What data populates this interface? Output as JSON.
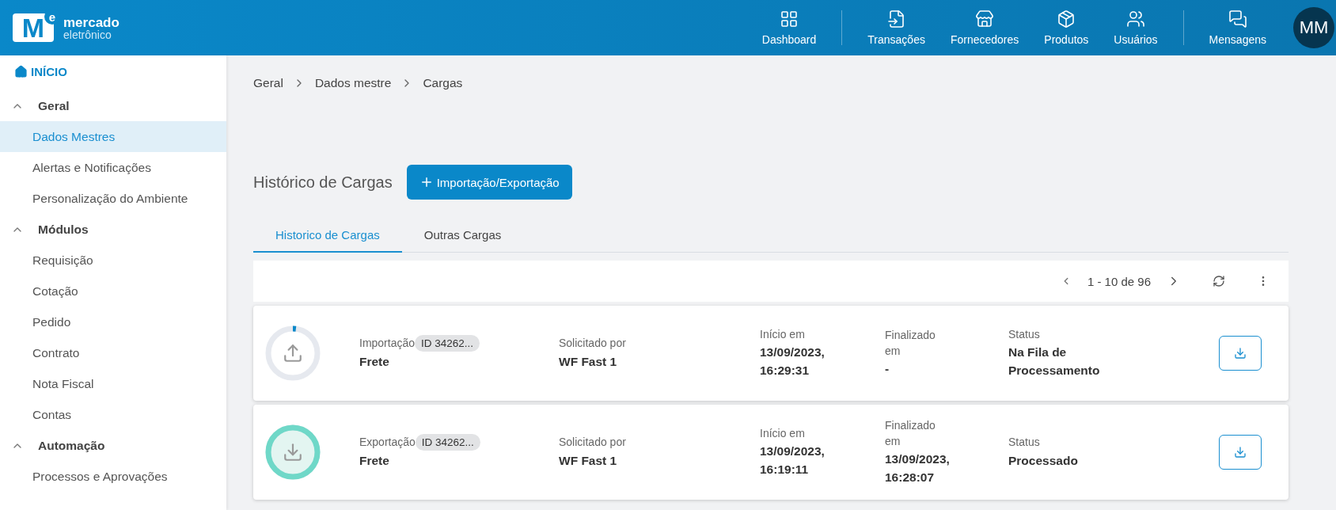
{
  "header": {
    "logo": {
      "letter": "M",
      "mark": "e",
      "name": "mercado",
      "subname": "eletrônico"
    },
    "nav": [
      {
        "label": "Dashboard"
      },
      {
        "label": "Transações"
      },
      {
        "label": "Fornecedores"
      },
      {
        "label": "Produtos"
      },
      {
        "label": "Usuários"
      },
      {
        "label": "Mensagens"
      }
    ],
    "avatar": "MM"
  },
  "sidebar": {
    "home": "INÍCIO",
    "groups": [
      {
        "label": "Geral",
        "expanded": true,
        "items": [
          {
            "label": "Dados Mestres",
            "selected": true
          },
          {
            "label": "Alertas e Notificações",
            "selected": false
          },
          {
            "label": "Personalização do Ambiente",
            "selected": false
          }
        ]
      },
      {
        "label": "Módulos",
        "expanded": true,
        "items": [
          {
            "label": "Requisição",
            "selected": false
          },
          {
            "label": "Cotação",
            "selected": false
          },
          {
            "label": "Pedido",
            "selected": false
          },
          {
            "label": "Contrato",
            "selected": false
          },
          {
            "label": "Nota Fiscal",
            "selected": false
          },
          {
            "label": "Contas",
            "selected": false
          }
        ]
      },
      {
        "label": "Automação",
        "expanded": true,
        "items": [
          {
            "label": "Processos e Aprovações",
            "selected": false
          }
        ]
      }
    ]
  },
  "breadcrumb": [
    "Geral",
    "Dados mestre",
    "Cargas"
  ],
  "title": "Histórico de Cargas",
  "action_button": "Importação/Exportação",
  "tabs": [
    {
      "label": "Historico de Cargas",
      "selected": true
    },
    {
      "label": "Outras Cargas",
      "selected": false
    }
  ],
  "pagination": {
    "range": "1 - 10 de 96"
  },
  "loads": [
    {
      "kind": "import",
      "type": "Importação",
      "id": "ID 34262...",
      "name": "Frete",
      "level": 0.02,
      "requested_label": "Solicitado por",
      "requested_by": "WF Fast 1",
      "start_label": "Início em",
      "start": "13/09/2023, 16:29:31",
      "end_label": "Finalizado em",
      "end": "-",
      "status_label": "Status",
      "status": "Na Fila de Processamento"
    },
    {
      "kind": "export",
      "type": "Exportação",
      "id": "ID 34262...",
      "name": "Frete",
      "level": 1,
      "requested_label": "Solicitado por",
      "requested_by": "WF Fast 1",
      "start_label": "Início em",
      "start": "13/09/2023, 16:19:11",
      "end_label": "Finalizado em",
      "end": "13/09/2023, 16:28:07",
      "status_label": "Status",
      "status": "Processado"
    }
  ]
}
